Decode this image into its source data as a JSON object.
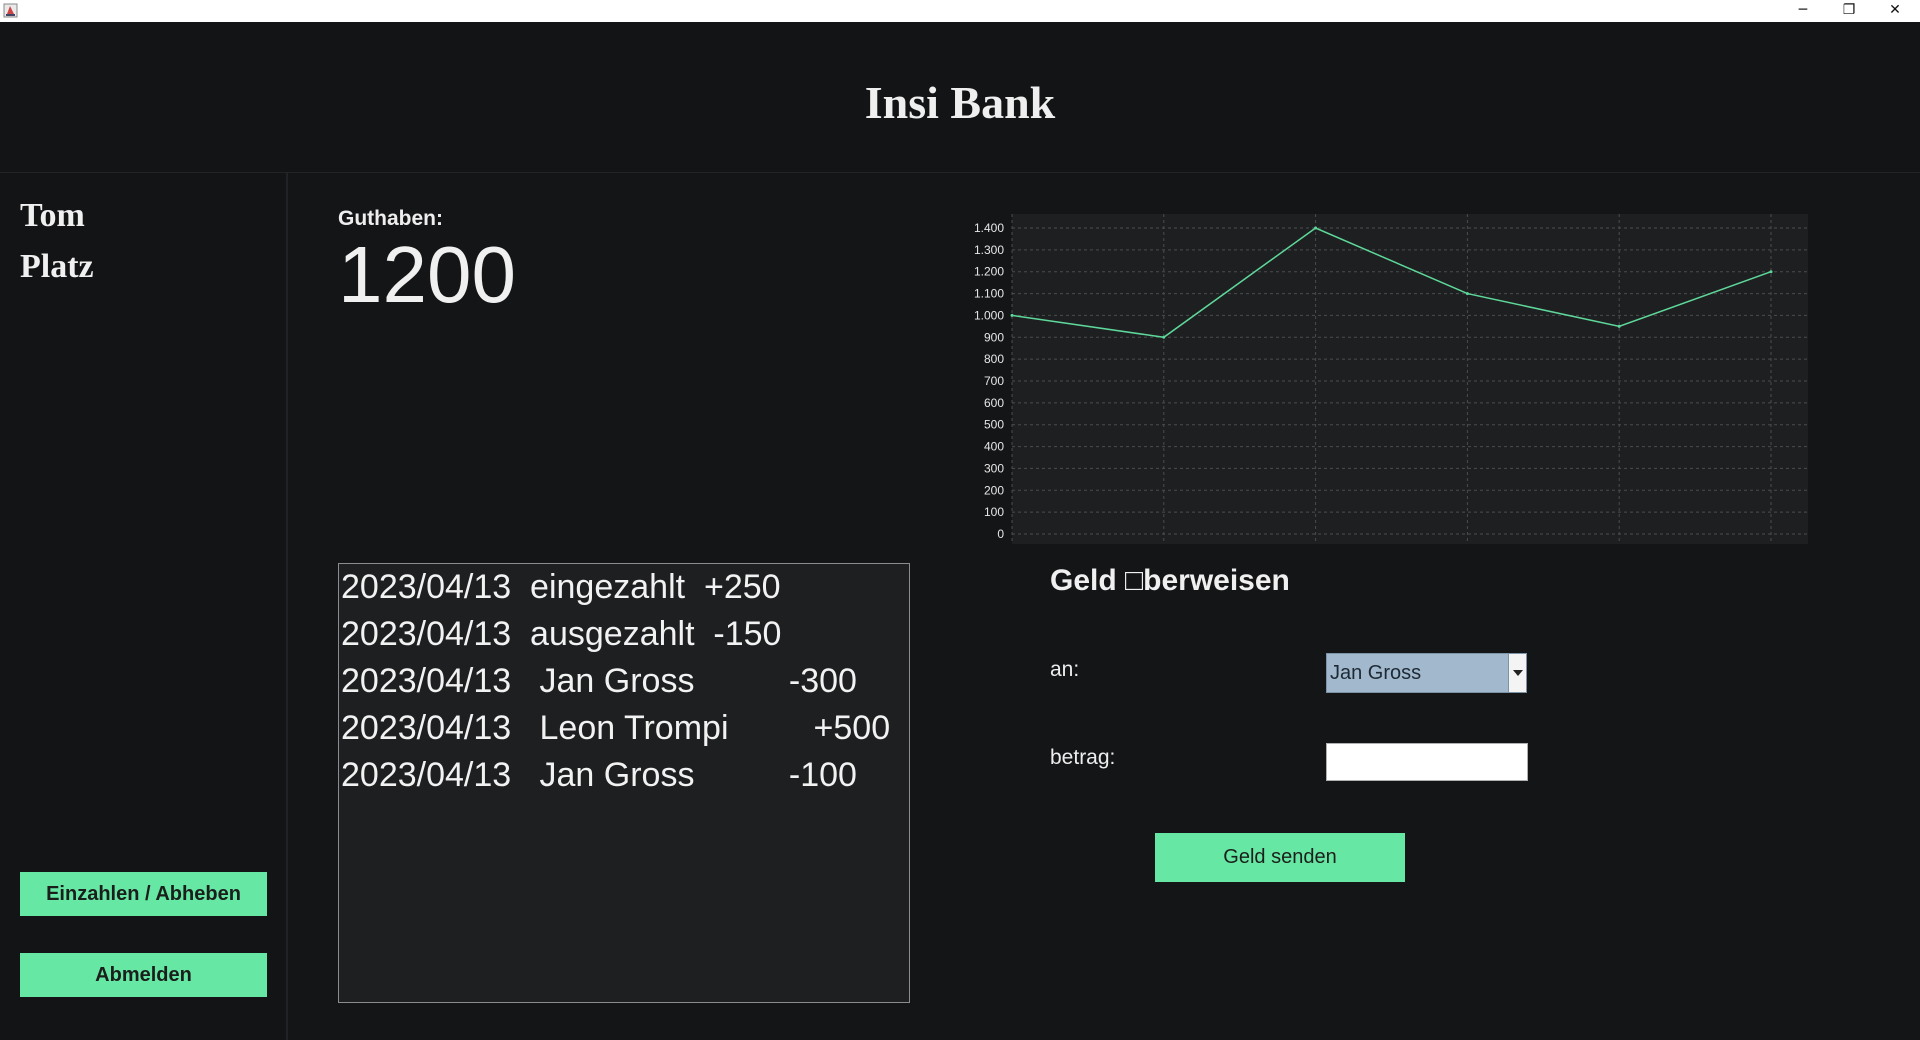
{
  "window": {
    "minimize_glyph": "─",
    "restore_glyph": "❐",
    "close_glyph": "✕"
  },
  "header": {
    "title": "Insi Bank"
  },
  "sidebar": {
    "first_name": "Tom",
    "last_name": "Platz",
    "deposit_button": "Einzahlen / Abheben",
    "logout_button": "Abmelden"
  },
  "balance": {
    "label": "Guthaben:",
    "value": "1200"
  },
  "transactions": [
    "2023/04/13  eingezahlt  +250",
    "2023/04/13  ausgezahlt  -150",
    "2023/04/13   Jan Gross          -300",
    "2023/04/13   Leon Trompi         +500",
    "2023/04/13   Jan Gross          -100"
  ],
  "transfer": {
    "title": "Geld □berweisen",
    "recipient_label": "an:",
    "recipient_value": "Jan Gross",
    "amount_label": "betrag:",
    "amount_value": "",
    "send_button": "Geld senden"
  },
  "colors": {
    "accent": "#66e8a4",
    "line": "#5ed89a",
    "background": "#141517"
  },
  "chart_data": {
    "type": "line",
    "x": [
      1,
      2,
      3,
      4,
      5,
      6
    ],
    "series": [
      {
        "values": [
          1000,
          900,
          1400,
          1100,
          950,
          1200
        ]
      }
    ],
    "ylim": [
      0,
      1400
    ],
    "yticks": [
      0,
      100,
      200,
      300,
      400,
      500,
      600,
      700,
      800,
      900,
      1000,
      1100,
      1200,
      1300,
      1400
    ],
    "ytick_labels": [
      "0",
      "100",
      "200",
      "300",
      "400",
      "500",
      "600",
      "700",
      "800",
      "900",
      "1.000",
      "1.100",
      "1.200",
      "1.300",
      "1.400"
    ],
    "grid": true,
    "title": "",
    "xlabel": "",
    "ylabel": ""
  }
}
